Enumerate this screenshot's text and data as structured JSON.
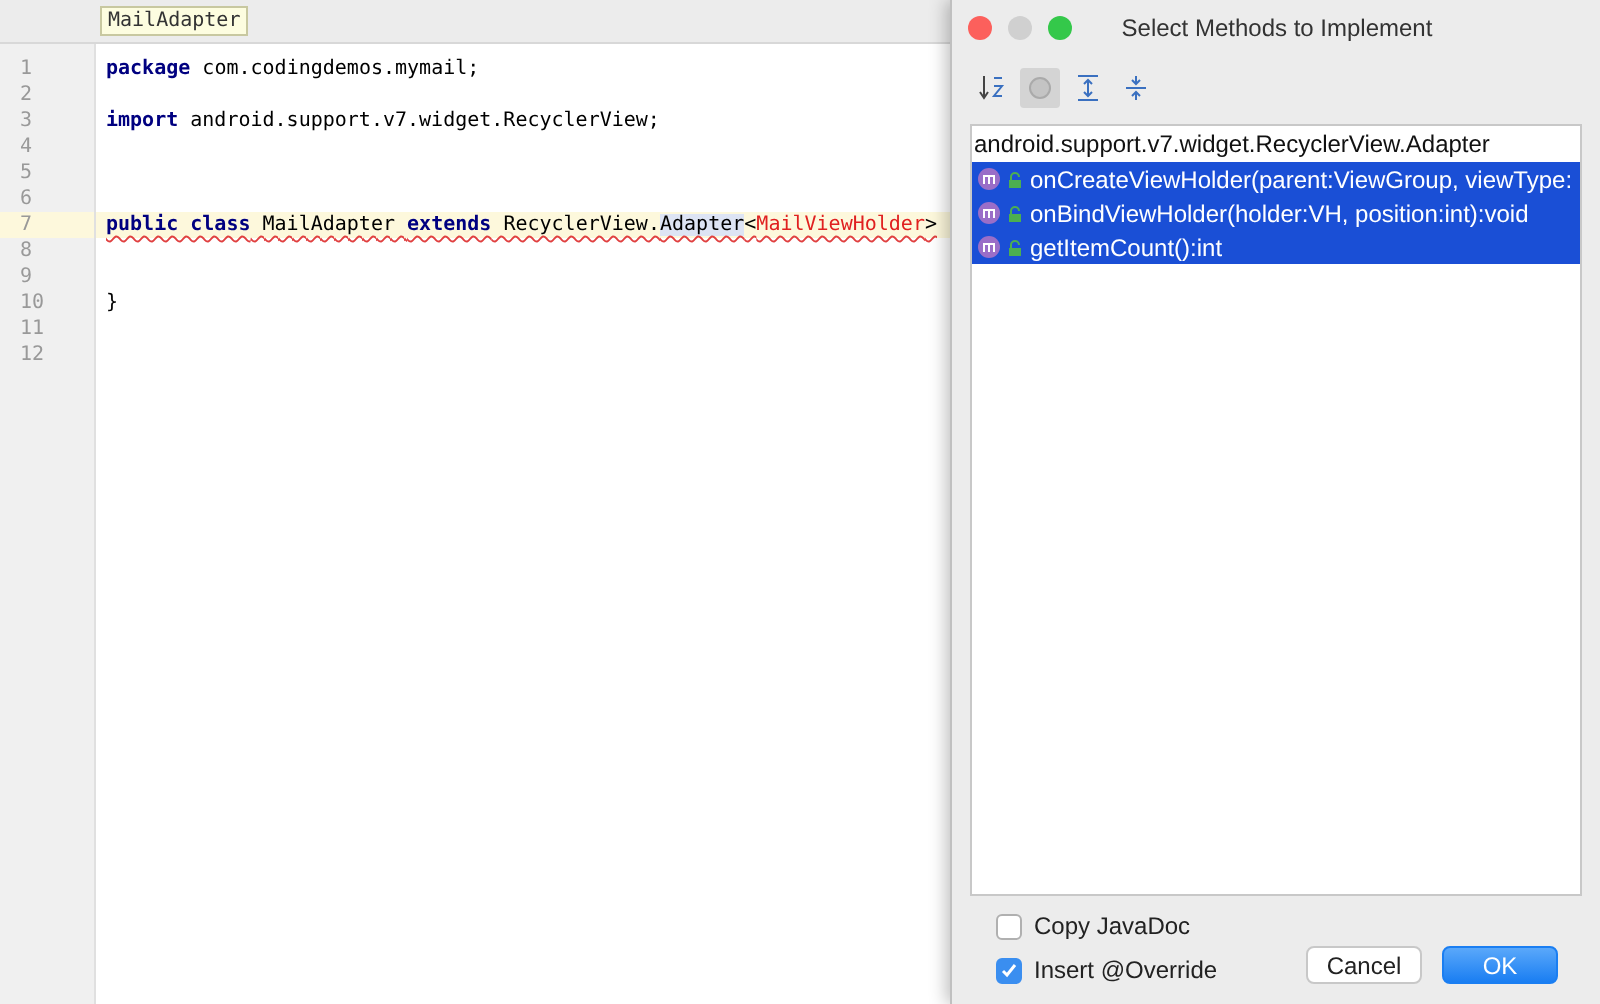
{
  "editor": {
    "breadcrumb": "MailAdapter",
    "lines": [
      {
        "number": "1",
        "current": false,
        "tokens": [
          {
            "text": "package",
            "kind": "keyword"
          },
          {
            "text": " com.codingdemos.mymail;",
            "kind": "plain"
          }
        ]
      },
      {
        "number": "2",
        "current": false
      },
      {
        "number": "3",
        "current": false,
        "tokens": [
          {
            "text": "import",
            "kind": "keyword"
          },
          {
            "text": " android.support.v7.widget.RecyclerView;",
            "kind": "plain"
          }
        ]
      },
      {
        "number": "4",
        "current": false
      },
      {
        "number": "5",
        "current": false
      },
      {
        "number": "6",
        "current": false
      },
      {
        "number": "7",
        "current": true,
        "error_underline": true,
        "tokens": [
          {
            "text": "public class",
            "kind": "keyword"
          },
          {
            "text": " MailAdapter ",
            "kind": "plain"
          },
          {
            "text": "extends",
            "kind": "keyword"
          },
          {
            "text": " RecyclerView.",
            "kind": "plain"
          },
          {
            "text": "Adapter",
            "kind": "reference"
          },
          {
            "text": "<",
            "kind": "plain"
          },
          {
            "text": "MailViewHolder",
            "kind": "error"
          },
          {
            "text": ">",
            "kind": "plain"
          }
        ]
      },
      {
        "number": "8",
        "current": false
      },
      {
        "number": "9",
        "current": false
      },
      {
        "number": "10",
        "current": false,
        "tokens": [
          {
            "text": "}",
            "kind": "plain"
          }
        ]
      },
      {
        "number": "11",
        "current": false
      },
      {
        "number": "12",
        "current": false
      }
    ]
  },
  "dialog": {
    "title": "Select Methods to Implement",
    "toolbar": [
      {
        "kind": "sort",
        "pressed": false
      },
      {
        "kind": "show-classes",
        "pressed": true
      },
      {
        "kind": "expand-all",
        "pressed": false
      },
      {
        "kind": "collapse-all",
        "pressed": false
      }
    ],
    "group": "android.support.v7.widget.RecyclerView.Adapter",
    "methods": [
      {
        "signature": "onCreateViewHolder(parent:ViewGroup, viewType:",
        "selected": true
      },
      {
        "signature": "onBindViewHolder(holder:VH, position:int):void",
        "selected": true
      },
      {
        "signature": "getItemCount():int",
        "selected": true
      }
    ],
    "options": [
      {
        "label": "Copy JavaDoc",
        "checked": false
      },
      {
        "label": "Insert @Override",
        "checked": true
      }
    ],
    "buttons": [
      {
        "label": "Cancel",
        "default": false
      },
      {
        "label": "OK",
        "default": true
      }
    ]
  }
}
